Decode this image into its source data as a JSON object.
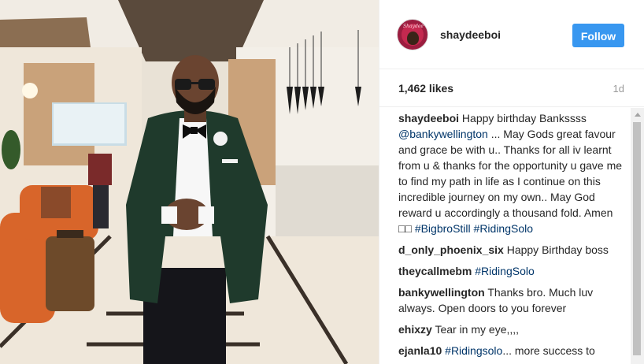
{
  "post": {
    "username": "shaydeeboi",
    "follow_label": "Follow",
    "avatar_text": "Shaydee",
    "likes": "1,462 likes",
    "time": "1d"
  },
  "comments": [
    {
      "user": "shaydeeboi",
      "parts": [
        {
          "t": "text",
          "v": " Happy birthday Bankssss "
        },
        {
          "t": "tag",
          "v": "@bankywellington"
        },
        {
          "t": "text",
          "v": " ... May Gods great favour and grace be with u.. Thanks for all iv learnt from u & thanks for the opportunity u gave me to find my path in life as I continue on this incredible journey on my own.. May God reward u accordingly a thousand fold. Amen □□ "
        },
        {
          "t": "tag",
          "v": "#BigbroStill"
        },
        {
          "t": "text",
          "v": " "
        },
        {
          "t": "tag",
          "v": "#RidingSolo"
        }
      ]
    },
    {
      "user": "d_only_phoenix_six",
      "parts": [
        {
          "t": "text",
          "v": " Happy Birthday boss"
        }
      ]
    },
    {
      "user": "theycallmebm",
      "parts": [
        {
          "t": "text",
          "v": " "
        },
        {
          "t": "tag",
          "v": "#RidingSolo"
        }
      ]
    },
    {
      "user": "bankywellington",
      "parts": [
        {
          "t": "text",
          "v": " Thanks bro. Much luv always. Open doors to you forever"
        }
      ]
    },
    {
      "user": "ehixzy",
      "parts": [
        {
          "t": "text",
          "v": " Tear in my eye,,,,"
        }
      ]
    },
    {
      "user": "ejanla10",
      "parts": [
        {
          "t": "text",
          "v": " "
        },
        {
          "t": "tag",
          "v": "#Ridingsolo"
        },
        {
          "t": "text",
          "v": "... more success to"
        }
      ]
    }
  ]
}
